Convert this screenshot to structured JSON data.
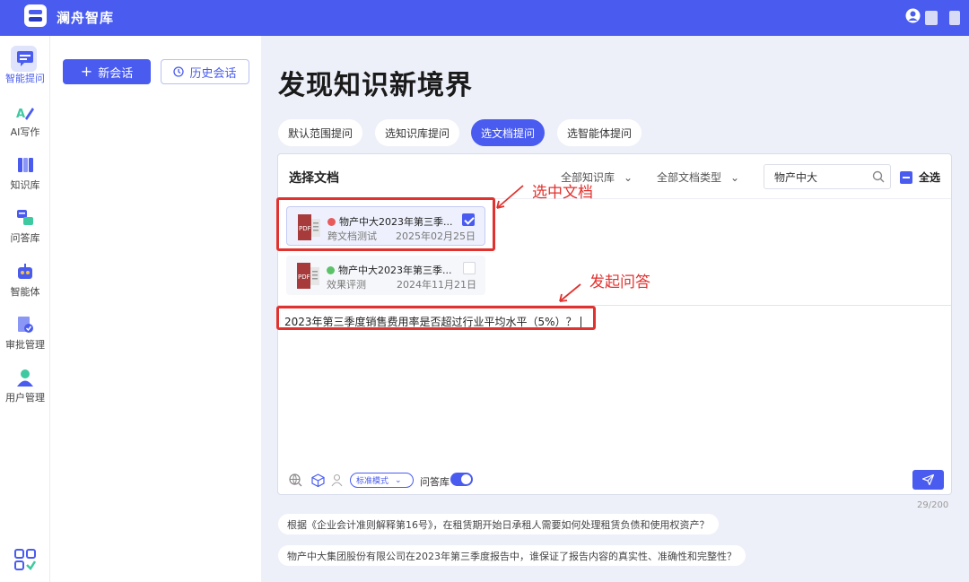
{
  "app": {
    "title": "澜舟智库"
  },
  "colors": {
    "brand": "#4a5cf0",
    "annotation": "#e0322e",
    "background": "#eef0f9"
  },
  "nav": {
    "items": [
      {
        "label": "智能提问",
        "icon": "chat-icon",
        "active": true
      },
      {
        "label": "AI写作",
        "icon": "ai-write-icon"
      },
      {
        "label": "知识库",
        "icon": "books-icon"
      },
      {
        "label": "问答库",
        "icon": "qa-icon"
      },
      {
        "label": "智能体",
        "icon": "robot-icon"
      },
      {
        "label": "审批管理",
        "icon": "approval-icon"
      },
      {
        "label": "用户管理",
        "icon": "user-icon"
      }
    ]
  },
  "side": {
    "new_chat": "新会话",
    "history": "历史会话"
  },
  "main": {
    "title": "发现知识新境界",
    "tabs": [
      "默认范围提问",
      "选知识库提问",
      "选文档提问",
      "选智能体提问"
    ],
    "active_tab": 2,
    "select_doc": {
      "title": "选择文档",
      "filter_kb": "全部知识库",
      "filter_type": "全部文档类型",
      "search_value": "物产中大",
      "select_all": "全选"
    },
    "docs": [
      {
        "name": "物产中大2023年第三季...",
        "source": "跨文档测试",
        "date": "2025年02月25日",
        "checked": true
      },
      {
        "name": "物产中大2023年第三季...",
        "source": "效果评测",
        "date": "2024年11月21日",
        "checked": false
      }
    ],
    "question": "2023年第三季度销售费用率是否超过行业平均水平（5%）？",
    "mode": "标准模式",
    "qa_toggle_label": "问答库",
    "qa_toggle_on": true,
    "counter": "29/200",
    "suggestions": [
      "根据《企业会计准则解释第16号》，在租赁期开始日承租人需要如何处理租赁负债和使用权资产？",
      "物产中大集团股份有限公司在2023年第三季度报告中，谁保证了报告内容的真实性、准确性和完整性？"
    ]
  },
  "annotations": {
    "select_doc": "选中文档",
    "start_qa": "发起问答"
  }
}
